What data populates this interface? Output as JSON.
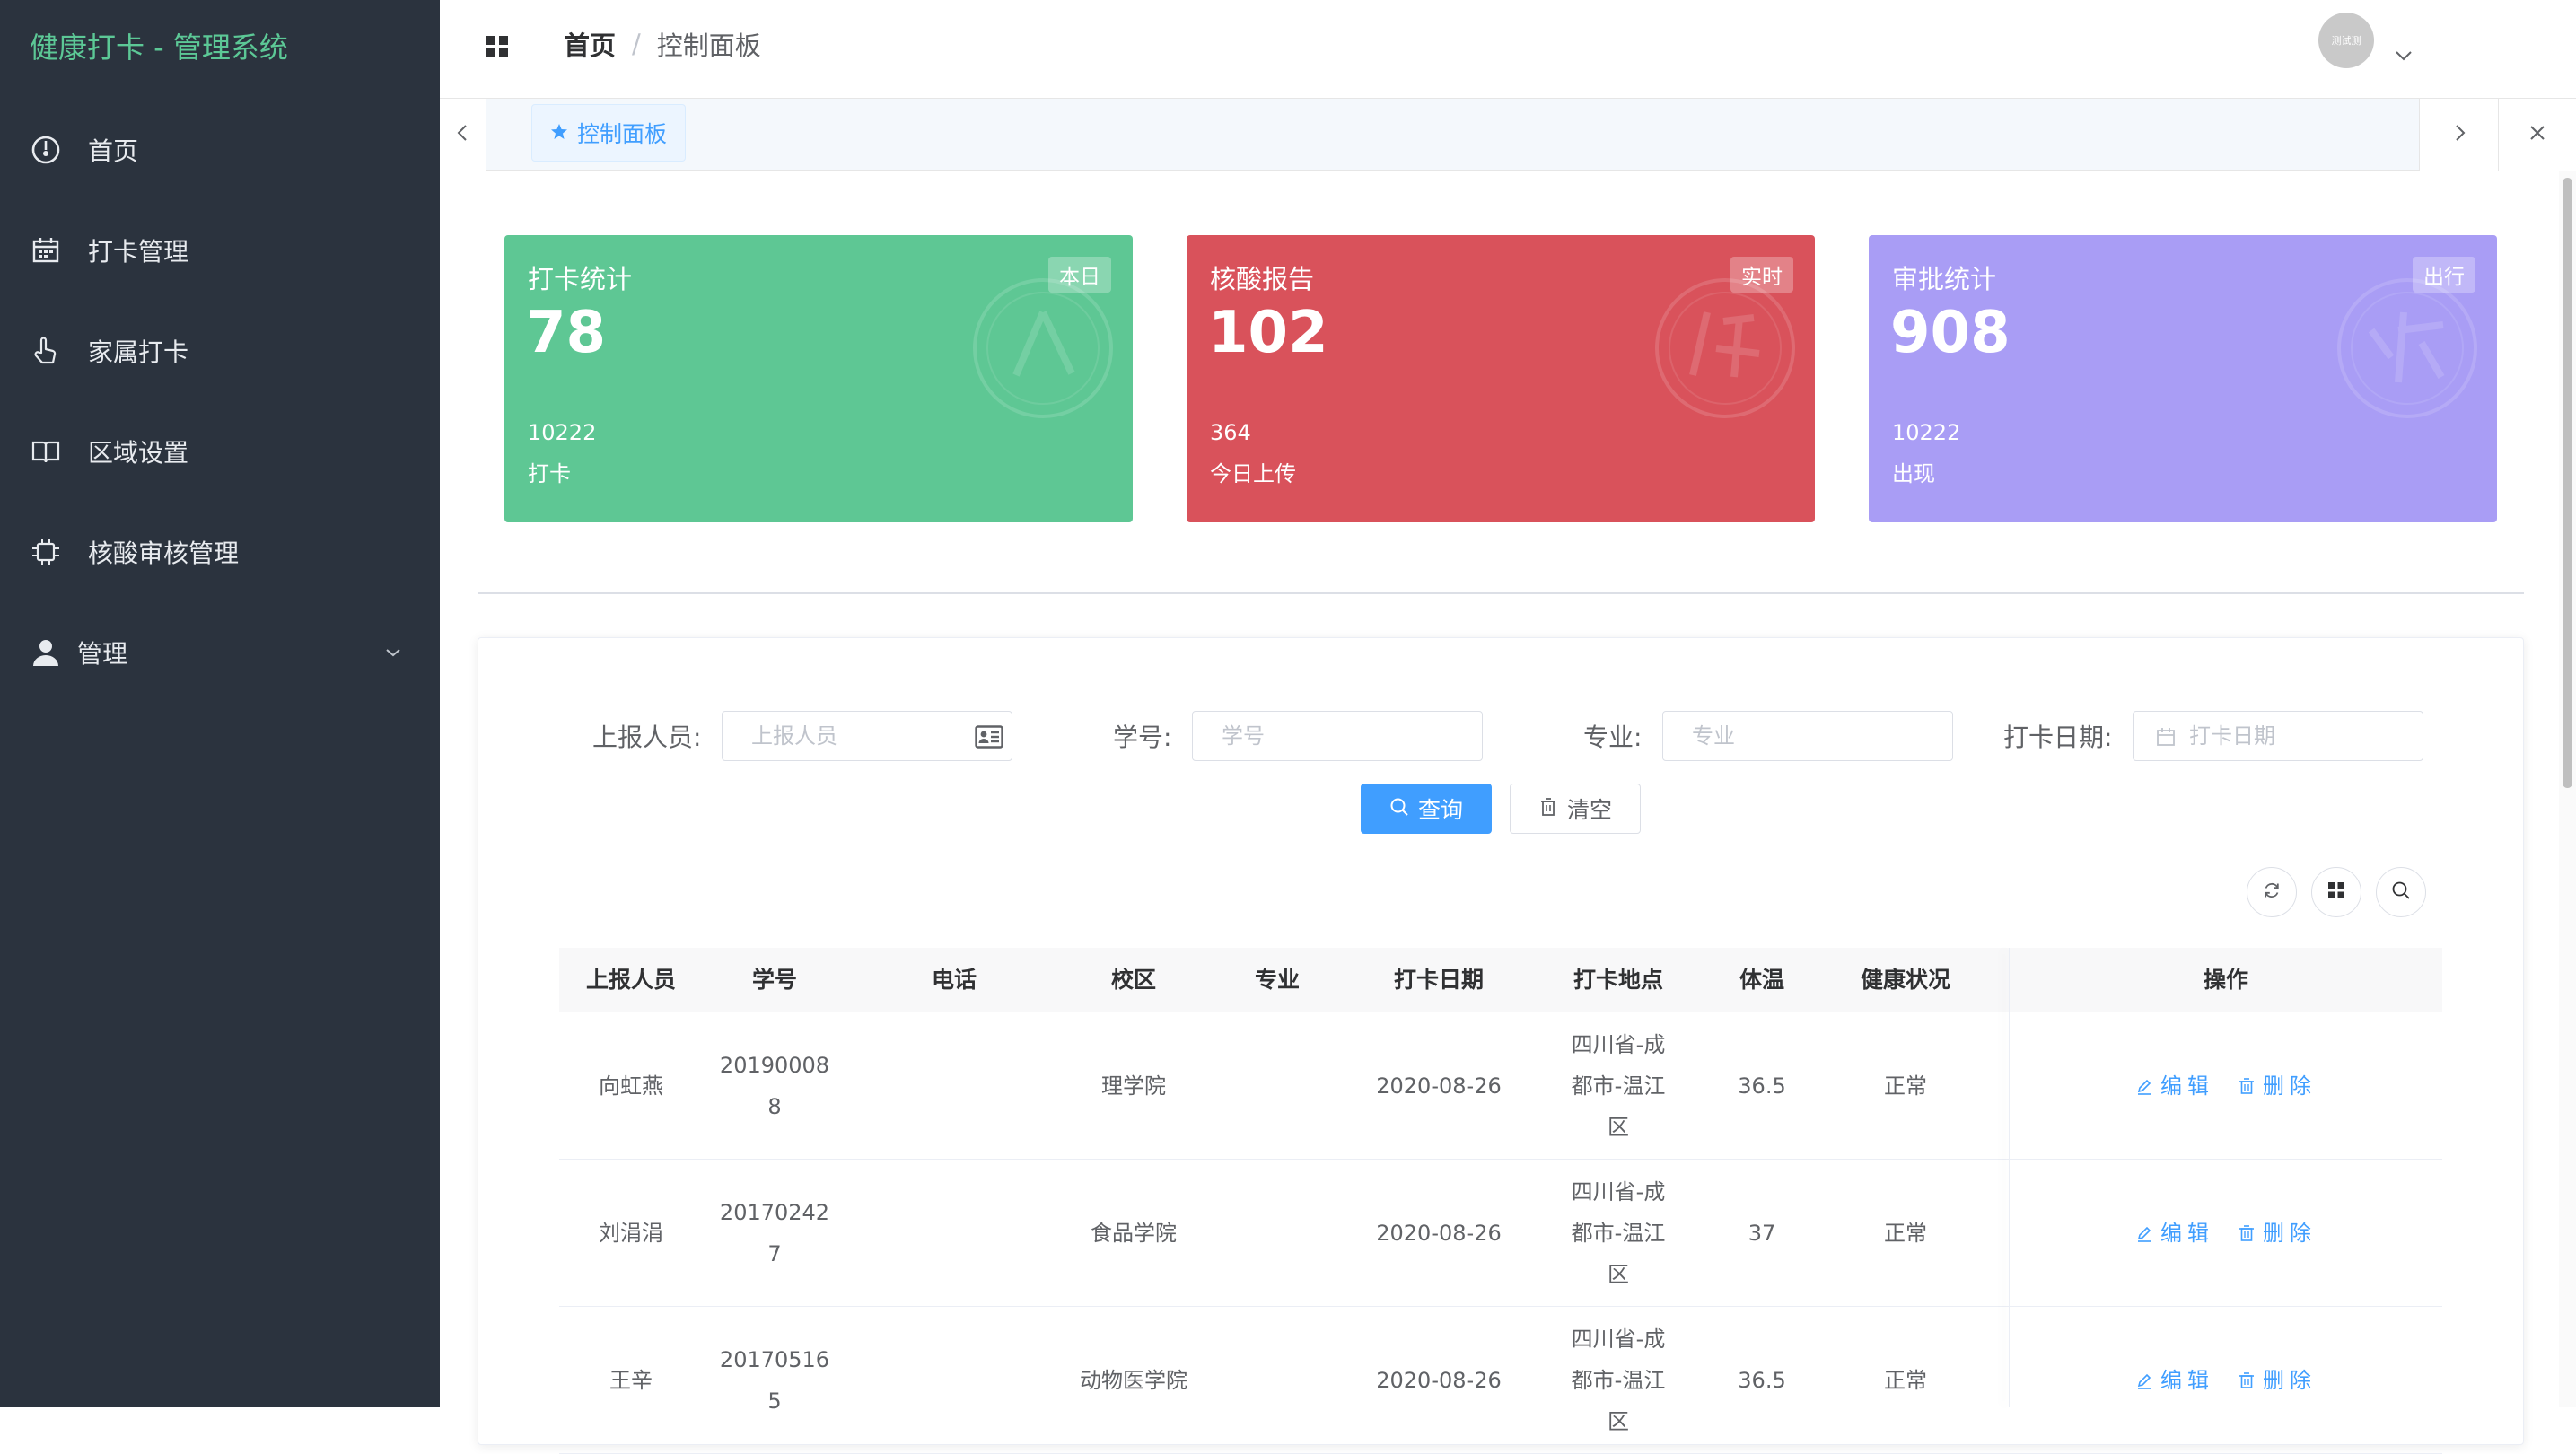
{
  "app": {
    "title": "健康打卡 - 管理系统"
  },
  "sidebar": {
    "items": [
      {
        "label": "首页",
        "icon": "dashboard-icon"
      },
      {
        "label": "打卡管理",
        "icon": "calendar-icon"
      },
      {
        "label": "家属打卡",
        "icon": "pointer-hand-icon"
      },
      {
        "label": "区域设置",
        "icon": "map-book-icon"
      },
      {
        "label": "核酸审核管理",
        "icon": "chip-icon"
      },
      {
        "label": "管理",
        "icon": "user-icon",
        "has_children": true
      }
    ]
  },
  "header": {
    "breadcrumb": {
      "home": "首页",
      "separator": "/",
      "current": "控制面板"
    },
    "avatar_text": "测试测"
  },
  "tags": {
    "active": "控制面板"
  },
  "cards": [
    {
      "title": "打卡统计",
      "badge": "本日",
      "value": "78",
      "sub": "10222",
      "desc": "打卡",
      "color": "#5ec794"
    },
    {
      "title": "核酸报告",
      "badge": "实时",
      "value": "102",
      "sub": "364",
      "desc": "今日上传",
      "color": "#d9525b"
    },
    {
      "title": "审批统计",
      "badge": "出行",
      "value": "908",
      "sub": "10222",
      "desc": "出现",
      "color": "#a99df5"
    }
  ],
  "filters": {
    "reporter": {
      "label": "上报人员:",
      "placeholder": "上报人员"
    },
    "student_id": {
      "label": "学号:",
      "placeholder": "学号"
    },
    "major": {
      "label": "专业:",
      "placeholder": "专业"
    },
    "checkin_date": {
      "label": "打卡日期:",
      "placeholder": "打卡日期"
    },
    "query_label": "查询",
    "clear_label": "清空"
  },
  "table": {
    "columns": [
      "上报人员",
      "学号",
      "电话",
      "校区",
      "专业",
      "打卡日期",
      "打卡地点",
      "体温",
      "健康状况",
      "操作"
    ],
    "rows": [
      {
        "reporter": "向虹燕",
        "student_id": [
          "20190008",
          "8"
        ],
        "phone": "",
        "campus": "理学院",
        "major": "",
        "date": "2020-08-26",
        "location": [
          "四川省-成",
          "都市-温江",
          "区"
        ],
        "temperature": "36.5",
        "health": "正常"
      },
      {
        "reporter": "刘涓涓",
        "student_id": [
          "20170242",
          "7"
        ],
        "phone": "",
        "campus": "食品学院",
        "major": "",
        "date": "2020-08-26",
        "location": [
          "四川省-成",
          "都市-温江",
          "区"
        ],
        "temperature": "37",
        "health": "正常"
      },
      {
        "reporter": "王辛",
        "student_id": [
          "20170516",
          "5"
        ],
        "phone": "",
        "campus": "动物医学院",
        "major": "",
        "date": "2020-08-26",
        "location": [
          "四川省-成",
          "都市-温江",
          "区"
        ],
        "temperature": "36.5",
        "health": "正常"
      }
    ],
    "edit_label": "编辑",
    "delete_label": "删除"
  },
  "colors": {
    "accent": "#409eff",
    "sidebar_bg": "#2b333e",
    "brand_green": "#5cc896"
  }
}
